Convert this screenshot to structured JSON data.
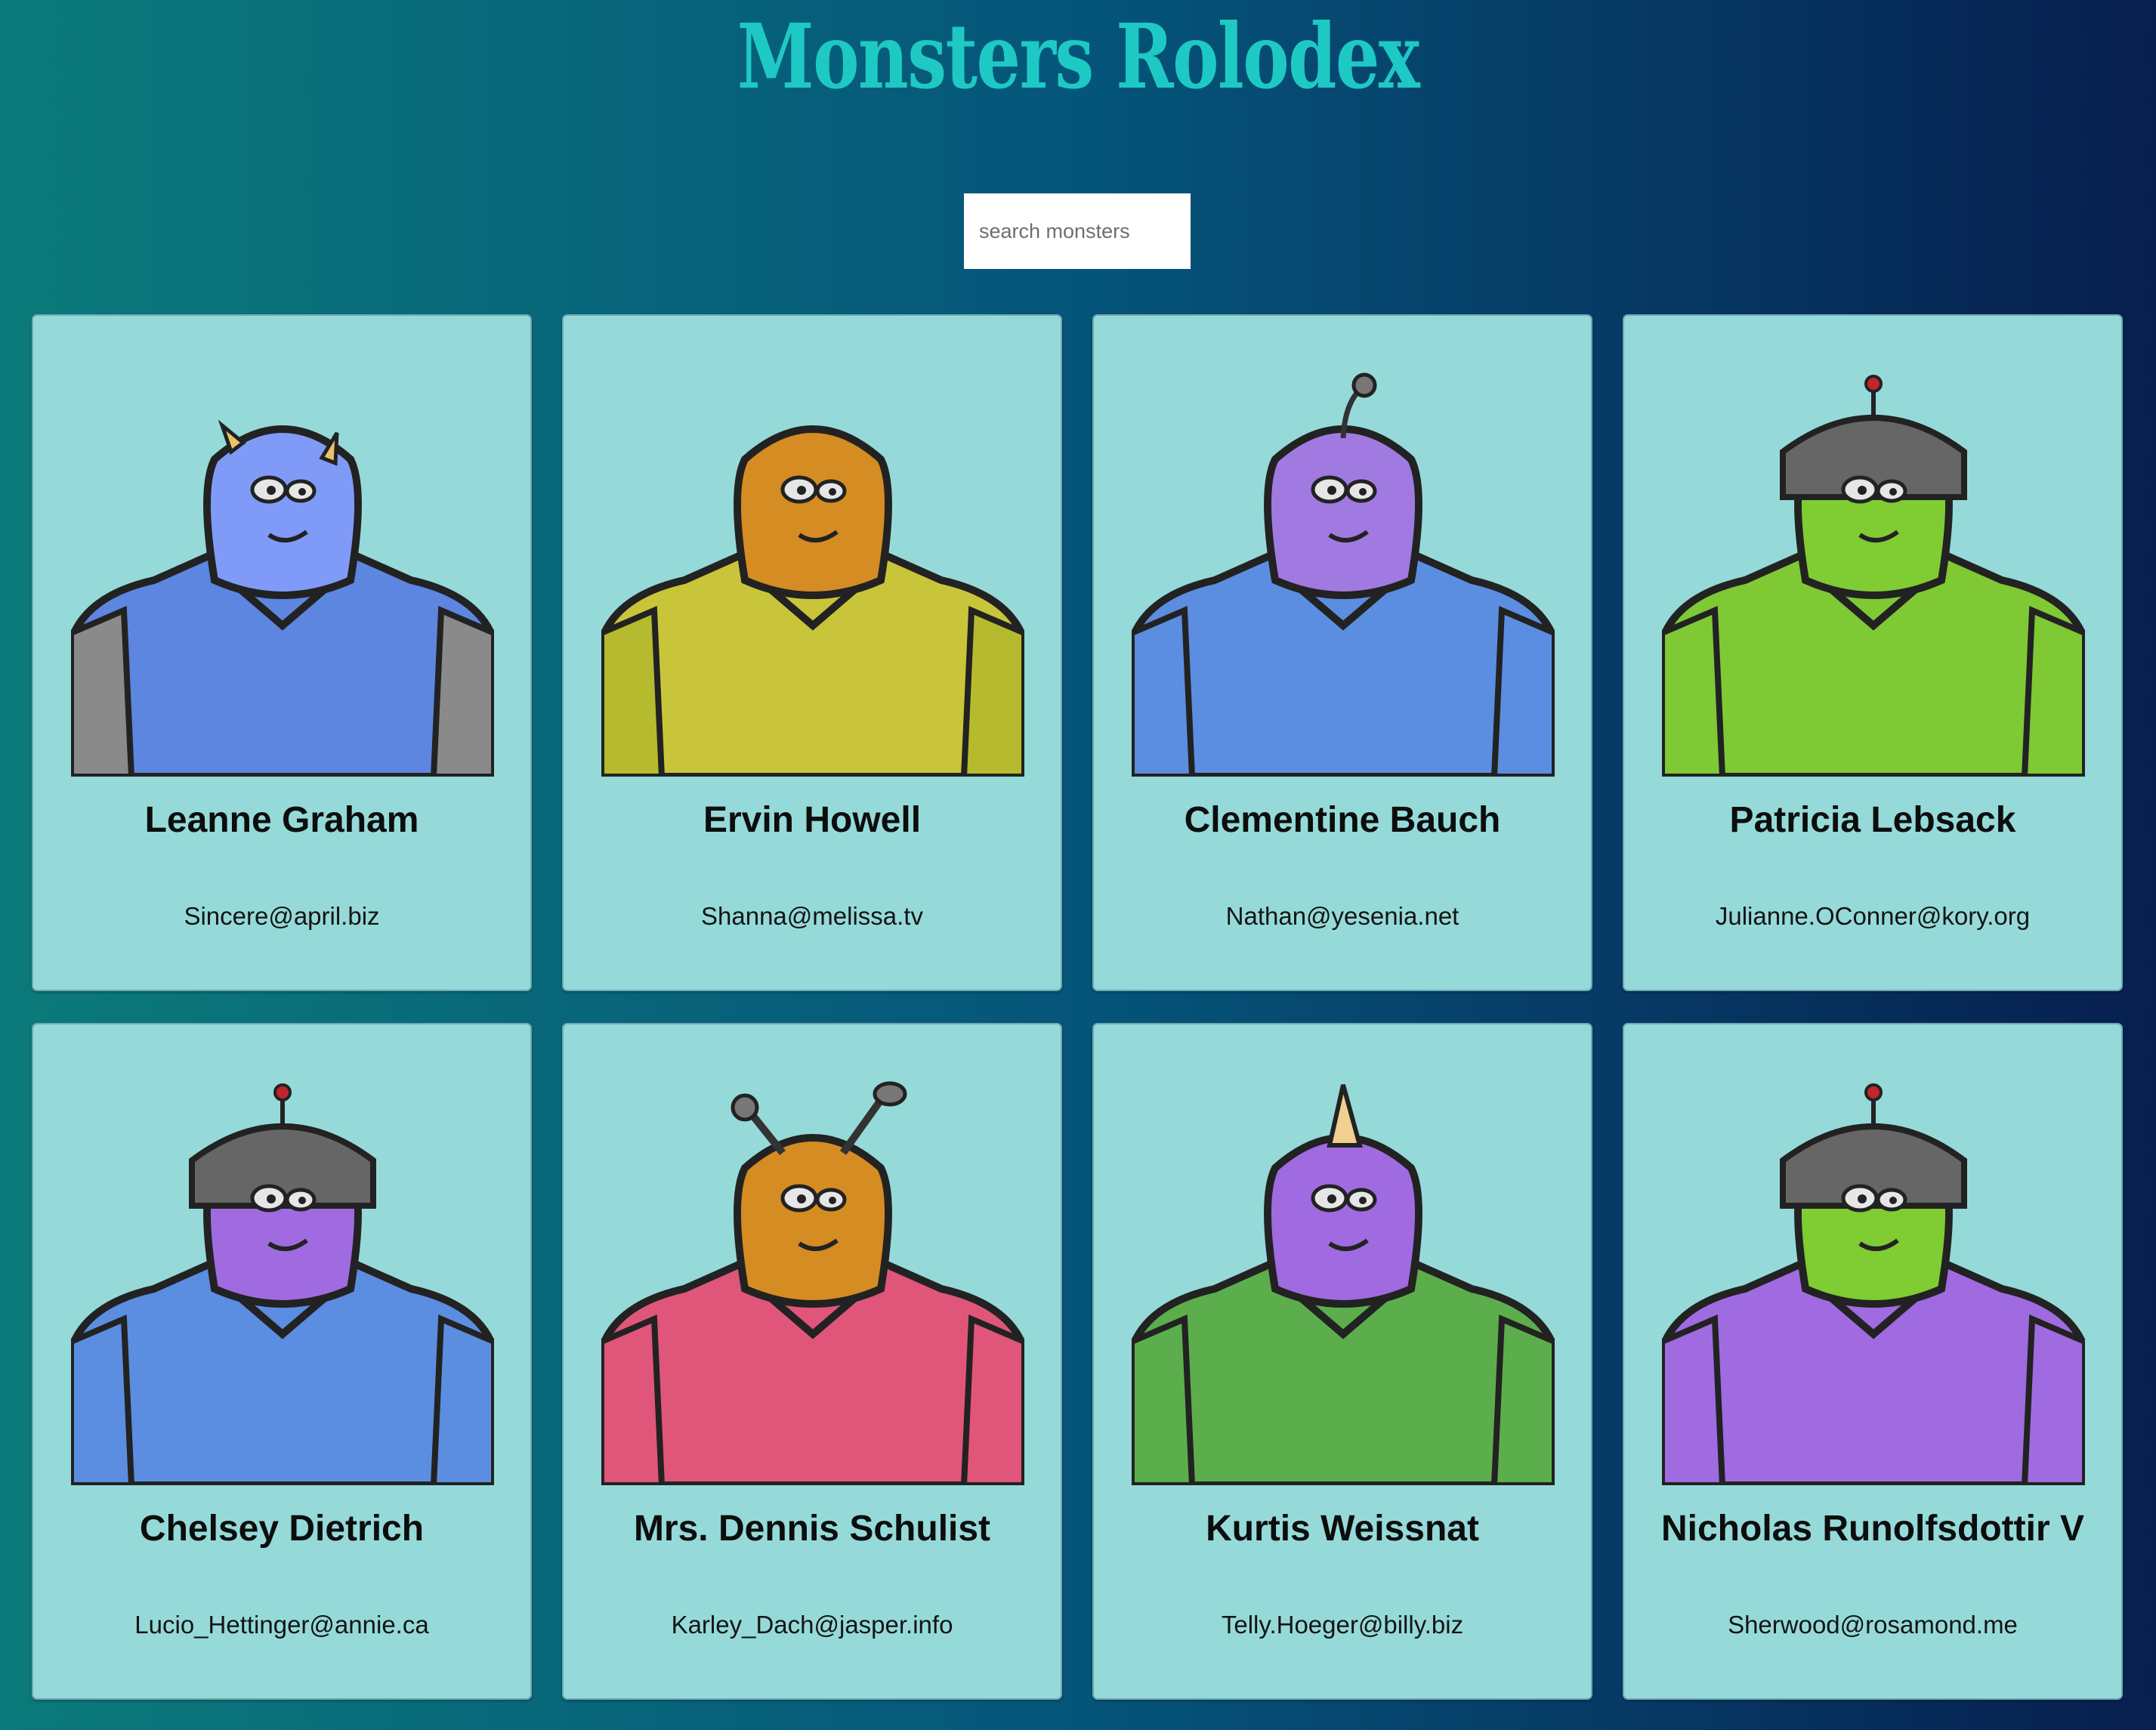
{
  "header": {
    "title": "Monsters Rolodex"
  },
  "search": {
    "placeholder": "search monsters"
  },
  "monsters": [
    {
      "name": "Leanne Graham",
      "email": "Sincere@april.biz",
      "head": "#7f9bf7",
      "body": "#5d86e0",
      "shoulder": "#8a8a8a",
      "accent": "#e9c36c",
      "feature": "horns"
    },
    {
      "name": "Ervin Howell",
      "email": "Shanna@melissa.tv",
      "head": "#d58c22",
      "body": "#c9c53a",
      "shoulder": "#b6ba2e",
      "accent": "#2a2a2a",
      "feature": "none"
    },
    {
      "name": "Clementine Bauch",
      "email": "Nathan@yesenia.net",
      "head": "#a07ae0",
      "body": "#5b8ee0",
      "shoulder": "#5b8ee0",
      "accent": "#555555",
      "feature": "antenna"
    },
    {
      "name": "Patricia Lebsack",
      "email": "Julianne.OConner@kory.org",
      "head": "#7fcc33",
      "body": "#7fc935",
      "shoulder": "#7fc935",
      "accent": "#666666",
      "feature": "helmet"
    },
    {
      "name": "Chelsey Dietrich",
      "email": "Lucio_Hettinger@annie.ca",
      "head": "#a06be0",
      "body": "#5b8ee0",
      "shoulder": "#5b8ee0",
      "accent": "#666666",
      "feature": "helmet"
    },
    {
      "name": "Mrs. Dennis Schulist",
      "email": "Karley_Dach@jasper.info",
      "head": "#d58c22",
      "body": "#e0567a",
      "shoulder": "#e0567a",
      "accent": "#555555",
      "feature": "antennae"
    },
    {
      "name": "Kurtis Weissnat",
      "email": "Telly.Hoeger@billy.biz",
      "head": "#a06be0",
      "body": "#5cae4c",
      "shoulder": "#5cae4c",
      "accent": "#f0cf90",
      "feature": "horn"
    },
    {
      "name": "Nicholas Runolfsdottir V",
      "email": "Sherwood@rosamond.me",
      "head": "#7fcc33",
      "body": "#a06be0",
      "shoulder": "#a06be0",
      "accent": "#666666",
      "feature": "helmet"
    }
  ]
}
